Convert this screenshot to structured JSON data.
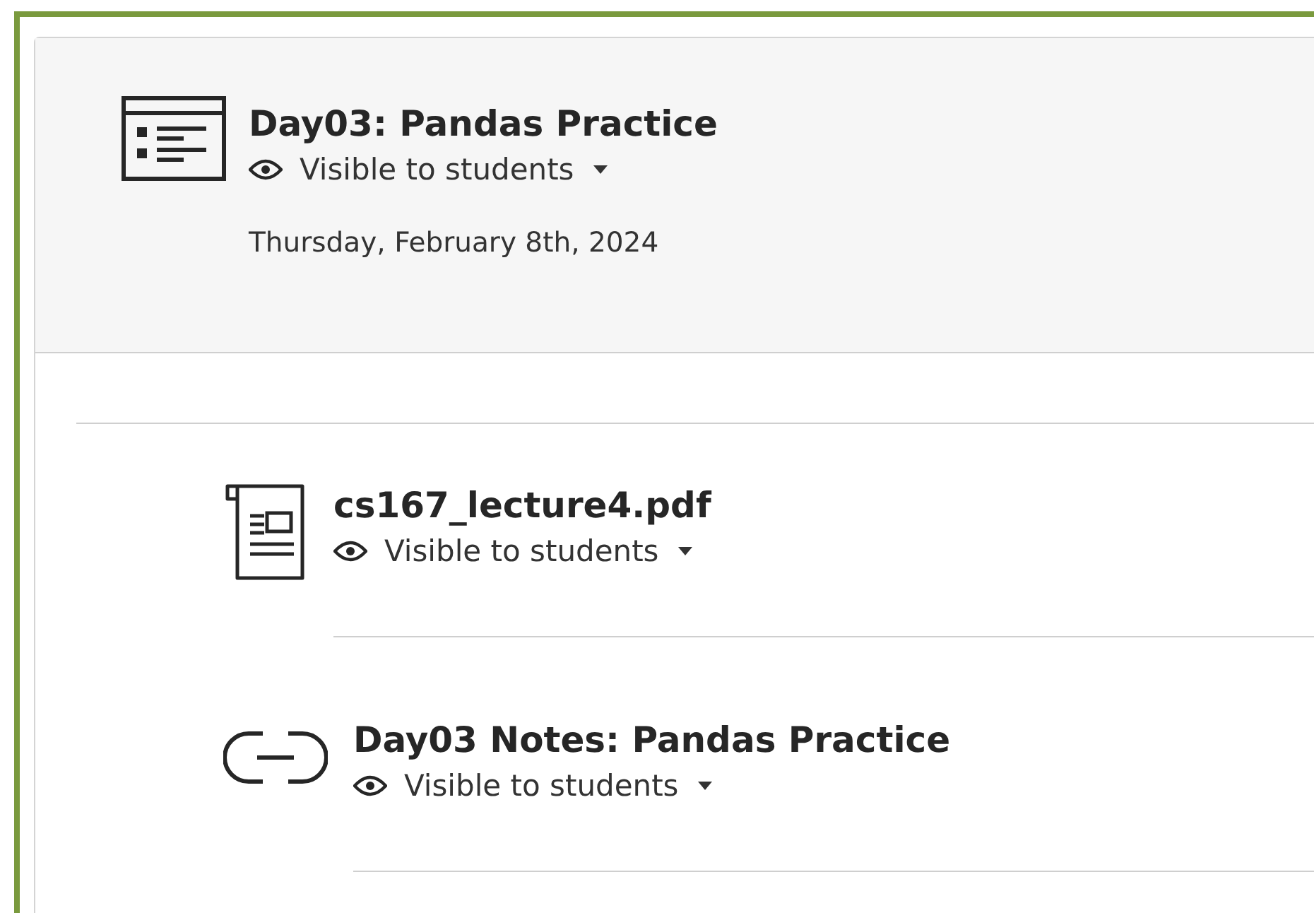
{
  "module": {
    "title": "Day03: Pandas Practice",
    "visibility": "Visible to students",
    "date": "Thursday, February 8th, 2024"
  },
  "items": [
    {
      "kind": "document",
      "title": "cs167_lecture4.pdf",
      "visibility": "Visible to students"
    },
    {
      "kind": "link",
      "title": "Day03 Notes: Pandas Practice",
      "visibility": "Visible to students"
    }
  ]
}
